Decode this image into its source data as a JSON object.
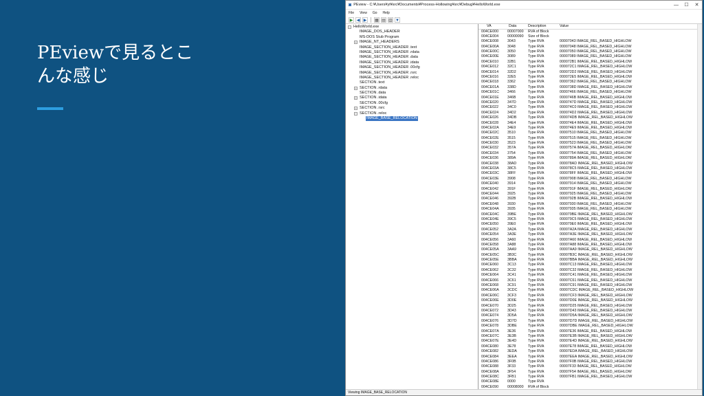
{
  "slide": {
    "title_line1": "PEviewで見るとこ",
    "title_line2": "んな感じ"
  },
  "window": {
    "title": "PEview - C:¥Users¥yt¥src¥Documents¥Process-Hollowing¥src¥Debug¥HelloWorld.exe",
    "minimize": "—",
    "maximize": "☐",
    "close": "✕"
  },
  "menu": [
    "File",
    "View",
    "Go",
    "Help"
  ],
  "tree": [
    {
      "label": "HelloWorld.exe",
      "level": 0,
      "exp": "−"
    },
    {
      "label": "IMAGE_DOS_HEADER",
      "level": 1,
      "exp": ""
    },
    {
      "label": "MS-DOS Stub Program",
      "level": 1,
      "exp": ""
    },
    {
      "label": "IMAGE_NT_HEADERS",
      "level": 1,
      "exp": "+"
    },
    {
      "label": "IMAGE_SECTION_HEADER .text",
      "level": 1,
      "exp": ""
    },
    {
      "label": "IMAGE_SECTION_HEADER .rdata",
      "level": 1,
      "exp": ""
    },
    {
      "label": "IMAGE_SECTION_HEADER .data",
      "level": 1,
      "exp": ""
    },
    {
      "label": "IMAGE_SECTION_HEADER .idata",
      "level": 1,
      "exp": ""
    },
    {
      "label": "IMAGE_SECTION_HEADER .00cfg",
      "level": 1,
      "exp": ""
    },
    {
      "label": "IMAGE_SECTION_HEADER .rsrc",
      "level": 1,
      "exp": ""
    },
    {
      "label": "IMAGE_SECTION_HEADER .reloc",
      "level": 1,
      "exp": ""
    },
    {
      "label": "SECTION .text",
      "level": 1,
      "exp": ""
    },
    {
      "label": "SECTION .rdata",
      "level": 1,
      "exp": "+"
    },
    {
      "label": "SECTION .data",
      "level": 1,
      "exp": ""
    },
    {
      "label": "SECTION .idata",
      "level": 1,
      "exp": "+"
    },
    {
      "label": "SECTION .00cfg",
      "level": 1,
      "exp": ""
    },
    {
      "label": "SECTION .rsrc",
      "level": 1,
      "exp": "+"
    },
    {
      "label": "SECTION .reloc",
      "level": 1,
      "exp": "−"
    },
    {
      "label": "IMAGE_BASE_RELOCATION",
      "level": 2,
      "exp": "",
      "selected": true
    }
  ],
  "columns": [
    "VA",
    "Data",
    "Description",
    "Value"
  ],
  "rows": [
    [
      "004CE000",
      "00007000",
      "RVA of Block",
      ""
    ],
    [
      "004CE004",
      "00000090",
      "Size of Block",
      ""
    ],
    [
      "004CE008",
      "3043",
      "Type RVA",
      "00007043 IMAGE_REL_BASED_HIGHLOW"
    ],
    [
      "004CE00A",
      "3048",
      "Type RVA",
      "00007048 IMAGE_REL_BASED_HIGHLOW"
    ],
    [
      "004CE00C",
      "3050",
      "Type RVA",
      "00007050 IMAGE_REL_BASED_HIGHLOW"
    ],
    [
      "004CE00E",
      "3089",
      "Type RVA",
      "00007089 IMAGE_REL_BASED_HIGHLOW"
    ],
    [
      "004CE010",
      "32B1",
      "Type RVA",
      "000072B1 IMAGE_REL_BASED_HIGHLOW"
    ],
    [
      "004CE012",
      "32C1",
      "Type RVA",
      "000072C1 IMAGE_REL_BASED_HIGHLOW"
    ],
    [
      "004CE014",
      "32D2",
      "Type RVA",
      "000072D2 IMAGE_REL_BASED_HIGHLOW"
    ],
    [
      "004CE016",
      "32E5",
      "Type RVA",
      "000072E5 IMAGE_REL_BASED_HIGHLOW"
    ],
    [
      "004CE018",
      "3362",
      "Type RVA",
      "00007362 IMAGE_REL_BASED_HIGHLOW"
    ],
    [
      "004CE01A",
      "338D",
      "Type RVA",
      "0000738D IMAGE_REL_BASED_HIGHLOW"
    ],
    [
      "004CE01C",
      "3466",
      "Type RVA",
      "00007466 IMAGE_REL_BASED_HIGHLOW"
    ],
    [
      "004CE01E",
      "346B",
      "Type RVA",
      "0000746B IMAGE_REL_BASED_HIGHLOW"
    ],
    [
      "004CE020",
      "347D",
      "Type RVA",
      "0000747D IMAGE_REL_BASED_HIGHLOW"
    ],
    [
      "004CE022",
      "34C0",
      "Type RVA",
      "000074C0 IMAGE_REL_BASED_HIGHLOW"
    ],
    [
      "004CE024",
      "34D2",
      "Type RVA",
      "000074D2 IMAGE_REL_BASED_HIGHLOW"
    ],
    [
      "004CE026",
      "34DB",
      "Type RVA",
      "000074DB IMAGE_REL_BASED_HIGHLOW"
    ],
    [
      "004CE028",
      "34E4",
      "Type RVA",
      "000074E4 IMAGE_REL_BASED_HIGHLOW"
    ],
    [
      "004CE02A",
      "34E9",
      "Type RVA",
      "000074E9 IMAGE_REL_BASED_HIGHLOW"
    ],
    [
      "004CE02C",
      "3510",
      "Type RVA",
      "00007510 IMAGE_REL_BASED_HIGHLOW"
    ],
    [
      "004CE02E",
      "3515",
      "Type RVA",
      "00007515 IMAGE_REL_BASED_HIGHLOW"
    ],
    [
      "004CE030",
      "3523",
      "Type RVA",
      "00007523 IMAGE_REL_BASED_HIGHLOW"
    ],
    [
      "004CE032",
      "357A",
      "Type RVA",
      "0000757A IMAGE_REL_BASED_HIGHLOW"
    ],
    [
      "004CE034",
      "3754",
      "Type RVA",
      "00007754 IMAGE_REL_BASED_HIGHLOW"
    ],
    [
      "004CE036",
      "389A",
      "Type RVA",
      "0000789A IMAGE_REL_BASED_HIGHLOW"
    ],
    [
      "004CE038",
      "38AD",
      "Type RVA",
      "000078AD IMAGE_REL_BASED_HIGHLOW"
    ],
    [
      "004CE03A",
      "38C5",
      "Type RVA",
      "000078C5 IMAGE_REL_BASED_HIGHLOW"
    ],
    [
      "004CE03C",
      "38FF",
      "Type RVA",
      "000078FF IMAGE_REL_BASED_HIGHLOW"
    ],
    [
      "004CE03E",
      "3908",
      "Type RVA",
      "00007908 IMAGE_REL_BASED_HIGHLOW"
    ],
    [
      "004CE040",
      "3914",
      "Type RVA",
      "00007914 IMAGE_REL_BASED_HIGHLOW"
    ],
    [
      "004CE042",
      "391F",
      "Type RVA",
      "0000791F IMAGE_REL_BASED_HIGHLOW"
    ],
    [
      "004CE044",
      "3925",
      "Type RVA",
      "00007925 IMAGE_REL_BASED_HIGHLOW"
    ],
    [
      "004CE046",
      "392B",
      "Type RVA",
      "0000792B IMAGE_REL_BASED_HIGHLOW"
    ],
    [
      "004CE048",
      "3930",
      "Type RVA",
      "00007930 IMAGE_REL_BASED_HIGHLOW"
    ],
    [
      "004CE04A",
      "3935",
      "Type RVA",
      "00007935 IMAGE_REL_BASED_HIGHLOW"
    ],
    [
      "004CE04C",
      "39BE",
      "Type RVA",
      "000079BE IMAGE_REL_BASED_HIGHLOW"
    ],
    [
      "004CE04E",
      "39C5",
      "Type RVA",
      "000079C5 IMAGE_REL_BASED_HIGHLOW"
    ],
    [
      "004CE050",
      "39E0",
      "Type RVA",
      "000079E0 IMAGE_REL_BASED_HIGHLOW"
    ],
    [
      "004CE052",
      "3A2A",
      "Type RVA",
      "00007A2A IMAGE_REL_BASED_HIGHLOW"
    ],
    [
      "004CE054",
      "3A3E",
      "Type RVA",
      "00007A3E IMAGE_REL_BASED_HIGHLOW"
    ],
    [
      "004CE056",
      "3A60",
      "Type RVA",
      "00007A60 IMAGE_REL_BASED_HIGHLOW"
    ],
    [
      "004CE058",
      "3A88",
      "Type RVA",
      "00007A88 IMAGE_REL_BASED_HIGHLOW"
    ],
    [
      "004CE05A",
      "3AA9",
      "Type RVA",
      "00007AA9 IMAGE_REL_BASED_HIGHLOW"
    ],
    [
      "004CE05C",
      "3B3C",
      "Type RVA",
      "00007B3C IMAGE_REL_BASED_HIGHLOW"
    ],
    [
      "004CE05E",
      "3BBA",
      "Type RVA",
      "00007BBA IMAGE_REL_BASED_HIGHLOW"
    ],
    [
      "004CE060",
      "3C13",
      "Type RVA",
      "00007C13 IMAGE_REL_BASED_HIGHLOW"
    ],
    [
      "004CE062",
      "3C32",
      "Type RVA",
      "00007C32 IMAGE_REL_BASED_HIGHLOW"
    ],
    [
      "004CE064",
      "3C41",
      "Type RVA",
      "00007C41 IMAGE_REL_BASED_HIGHLOW"
    ],
    [
      "004CE066",
      "3C61",
      "Type RVA",
      "00007C61 IMAGE_REL_BASED_HIGHLOW"
    ],
    [
      "004CE068",
      "3C91",
      "Type RVA",
      "00007C91 IMAGE_REL_BASED_HIGHLOW"
    ],
    [
      "004CE06A",
      "3CDC",
      "Type RVA",
      "00007CDC IMAGE_REL_BASED_HIGHLOW"
    ],
    [
      "004CE06C",
      "3CF3",
      "Type RVA",
      "00007CF3 IMAGE_REL_BASED_HIGHLOW"
    ],
    [
      "004CE06E",
      "3D0E",
      "Type RVA",
      "00007D0E IMAGE_REL_BASED_HIGHLOW"
    ],
    [
      "004CE070",
      "3D25",
      "Type RVA",
      "00007D25 IMAGE_REL_BASED_HIGHLOW"
    ],
    [
      "004CE072",
      "3D43",
      "Type RVA",
      "00007D43 IMAGE_REL_BASED_HIGHLOW"
    ],
    [
      "004CE074",
      "3D5A",
      "Type RVA",
      "00007D5A IMAGE_REL_BASED_HIGHLOW"
    ],
    [
      "004CE076",
      "3D7D",
      "Type RVA",
      "00007D7D IMAGE_REL_BASED_HIGHLOW"
    ],
    [
      "004CE078",
      "3DBE",
      "Type RVA",
      "00007DBE IMAGE_REL_BASED_HIGHLOW"
    ],
    [
      "004CE07A",
      "3E36",
      "Type RVA",
      "00007E36 IMAGE_REL_BASED_HIGHLOW"
    ],
    [
      "004CE07C",
      "3E3B",
      "Type RVA",
      "00007E3B IMAGE_REL_BASED_HIGHLOW"
    ],
    [
      "004CE07E",
      "3E4D",
      "Type RVA",
      "00007E4D IMAGE_REL_BASED_HIGHLOW"
    ],
    [
      "004CE080",
      "3E78",
      "Type RVA",
      "00007E78 IMAGE_REL_BASED_HIGHLOW"
    ],
    [
      "004CE082",
      "3EDA",
      "Type RVA",
      "00007EDA IMAGE_REL_BASED_HIGHLOW"
    ],
    [
      "004CE084",
      "3EEA",
      "Type RVA",
      "00007EEA IMAGE_REL_BASED_HIGHLOW"
    ],
    [
      "004CE086",
      "3F0B",
      "Type RVA",
      "00007F0B IMAGE_REL_BASED_HIGHLOW"
    ],
    [
      "004CE088",
      "3F33",
      "Type RVA",
      "00007F33 IMAGE_REL_BASED_HIGHLOW"
    ],
    [
      "004CE08A",
      "3F54",
      "Type RVA",
      "00007F54 IMAGE_REL_BASED_HIGHLOW"
    ],
    [
      "004CE08C",
      "3FB1",
      "Type RVA",
      "00007FB1 IMAGE_REL_BASED_HIGHLOW"
    ],
    [
      "004CE08E",
      "0000",
      "Type RVA",
      ""
    ],
    [
      "004CE090",
      "00008000",
      "RVA of Block",
      ""
    ],
    [
      "004CE094",
      "000000F8",
      "Size of Block",
      ""
    ]
  ],
  "status": "Viewing IMAGE_BASE_RELOCATION"
}
